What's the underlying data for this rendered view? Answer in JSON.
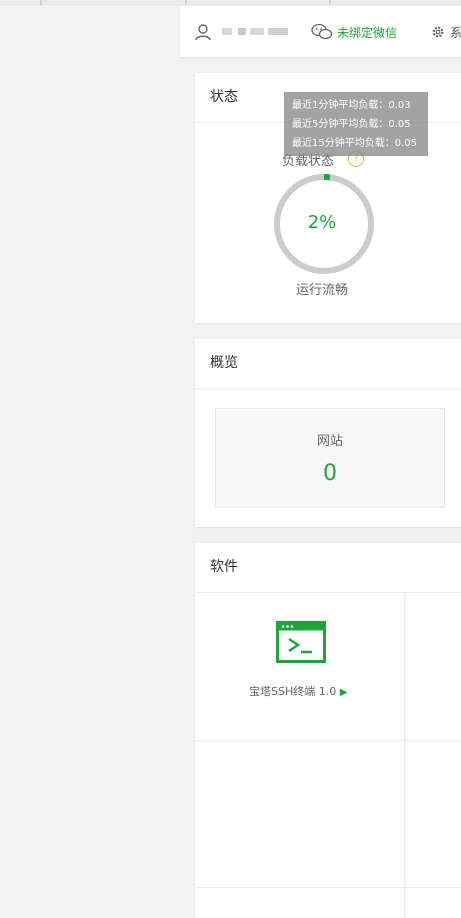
{
  "header": {
    "username": "",
    "wechat_status": "未绑定微信",
    "settings_label": "系"
  },
  "status": {
    "title": "状态",
    "load_label": "负载状态",
    "help_glyph": "?",
    "gauge_value": "2%",
    "gauge_fraction": 0.02,
    "load_status": "运行流畅",
    "tooltip": {
      "line1": "最近1分钟平均负载：0.03",
      "line2": "最近5分钟平均负载：0.05",
      "line3": "最近15分钟平均负载：0.05"
    }
  },
  "overview": {
    "title": "概览",
    "site_label": "网站",
    "site_count": "0"
  },
  "software": {
    "title": "软件",
    "item_label": "宝塔SSH终端 1.0",
    "item_action": "▶"
  },
  "colors": {
    "accent": "#20a53a",
    "gauge_track": "#cccccc",
    "warning": "#f0ad4e"
  }
}
